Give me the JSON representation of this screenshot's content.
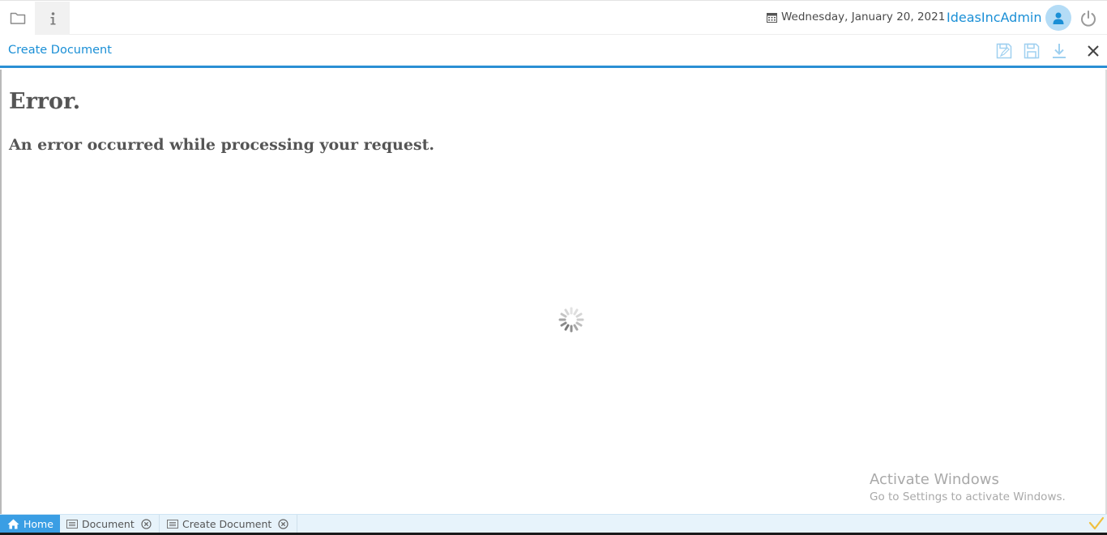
{
  "header": {
    "icons": {
      "folder": "folder-icon",
      "info": "info-icon",
      "calendar": "calendar-icon",
      "user": "user-icon",
      "power": "power-icon"
    },
    "date": "Wednesday, January 20, 2021",
    "username": "IdeasIncAdmin"
  },
  "document": {
    "title": "Create Document",
    "actions": [
      "save-as-icon",
      "save-icon",
      "download-icon",
      "close-icon"
    ]
  },
  "content": {
    "error_title": "Error.",
    "error_message": "An error occurred while processing your request.",
    "loading": "spinner-icon"
  },
  "watermark": {
    "title": "Activate Windows",
    "subtitle": "Go to Settings to activate Windows."
  },
  "tabs": [
    {
      "label": "Home",
      "icon": "home-icon",
      "active": true
    },
    {
      "label": "Document",
      "icon": "list-icon",
      "closable": true
    },
    {
      "label": "Create Document",
      "icon": "list-icon",
      "closable": true
    }
  ],
  "colors": {
    "accent": "#1a8fd6",
    "tab_active": "#3a9ee4",
    "avatar_bg": "#b4dcf6",
    "error_text": "#555555",
    "check": "#f0c040"
  }
}
